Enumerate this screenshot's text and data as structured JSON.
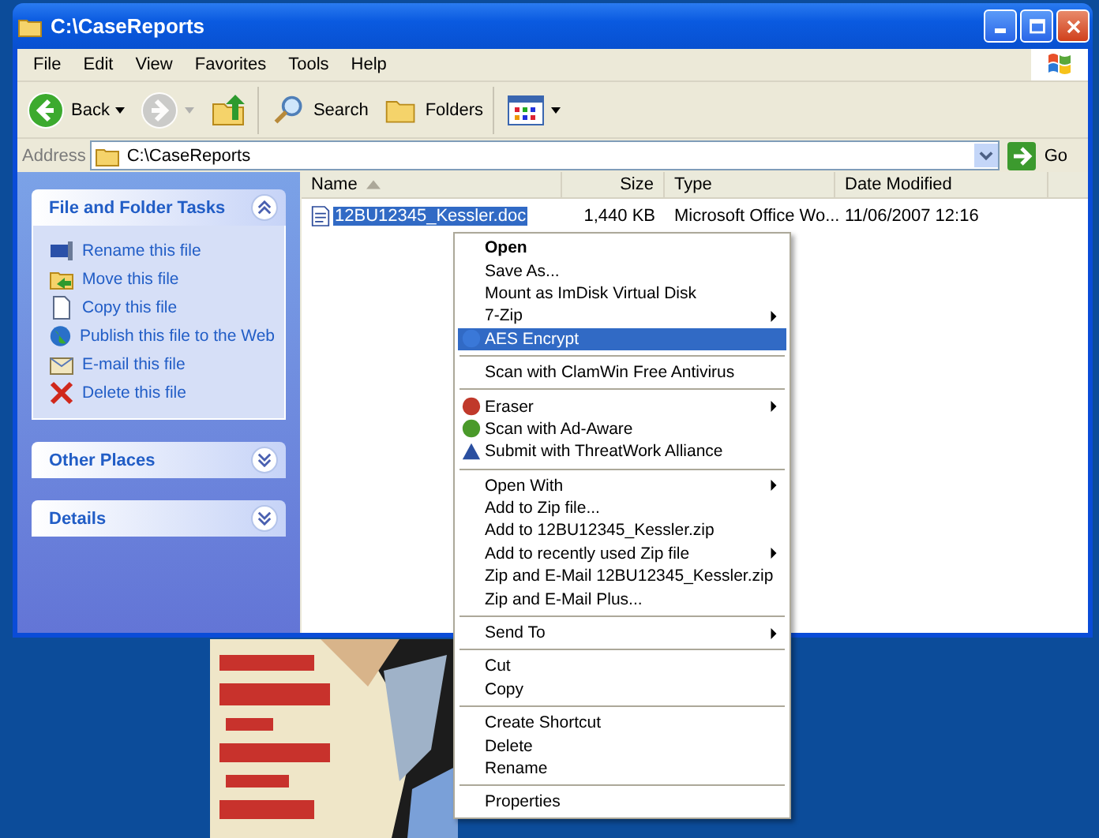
{
  "window": {
    "title": "C:\\CaseReports"
  },
  "menu_bar": [
    "File",
    "Edit",
    "View",
    "Favorites",
    "Tools",
    "Help"
  ],
  "toolbar": [
    {
      "kind": "back",
      "label": "Back",
      "disabled": false
    },
    {
      "kind": "forward",
      "disabled": true
    },
    {
      "kind": "up",
      "disabled": false
    },
    {
      "kind": "search",
      "label": "Search",
      "disabled": false
    },
    {
      "kind": "folders",
      "label": "Folders",
      "disabled": false
    },
    {
      "kind": "views",
      "disabled": false
    }
  ],
  "address_bar": {
    "label": "Address",
    "value": "C:\\CaseReports",
    "go": "Go"
  },
  "task_pane": [
    {
      "title": "File and Folder Tasks",
      "expanded": true,
      "items": [
        "Rename this file",
        "Move this file",
        "Copy this file",
        "Publish this file to the Web",
        "E-mail this file",
        "Delete this file"
      ]
    },
    {
      "title": "Other Places",
      "expanded": false
    },
    {
      "title": "Details",
      "expanded": false
    }
  ],
  "file_list": {
    "columns": [
      {
        "label": "Name",
        "sorted": true
      },
      {
        "label": "Size",
        "sorted": false
      },
      {
        "label": "Type",
        "sorted": false
      },
      {
        "label": "Date Modified",
        "sorted": false
      }
    ],
    "rows": [
      {
        "name": "12BU12345_Kessler.doc",
        "size": "1,440 KB",
        "type": "Microsoft Office Wo...",
        "date": "11/06/2007 12:16",
        "selected": true
      }
    ]
  },
  "context_menu": [
    [
      {
        "label": "Open",
        "default": true,
        "submenu": false,
        "icon": false,
        "selected": false
      },
      {
        "label": "Save As...",
        "default": false,
        "submenu": false,
        "icon": false,
        "selected": false
      },
      {
        "label": "Mount as ImDisk Virtual Disk",
        "default": false,
        "submenu": false,
        "icon": false,
        "selected": false
      },
      {
        "label": "7-Zip",
        "default": false,
        "submenu": true,
        "icon": false,
        "selected": false
      },
      {
        "label": "AES Encrypt",
        "default": false,
        "submenu": false,
        "icon": true,
        "selected": true
      }
    ],
    [
      {
        "label": "Scan with ClamWin Free Antivirus",
        "default": false,
        "submenu": false,
        "icon": false,
        "selected": false
      }
    ],
    [
      {
        "label": "Eraser",
        "default": false,
        "submenu": true,
        "icon": true,
        "selected": false
      },
      {
        "label": "Scan with Ad-Aware",
        "default": false,
        "submenu": false,
        "icon": true,
        "selected": false
      },
      {
        "label": "Submit with ThreatWork Alliance",
        "default": false,
        "submenu": false,
        "icon": true,
        "selected": false
      }
    ],
    [
      {
        "label": "Open With",
        "default": false,
        "submenu": true,
        "icon": false,
        "selected": false
      },
      {
        "label": "Add to Zip file...",
        "default": false,
        "submenu": false,
        "icon": false,
        "selected": false
      },
      {
        "label": "Add to 12BU12345_Kessler.zip",
        "default": false,
        "submenu": false,
        "icon": false,
        "selected": false
      },
      {
        "label": "Add to recently used Zip file",
        "default": false,
        "submenu": true,
        "icon": false,
        "selected": false
      },
      {
        "label": "Zip and E-Mail 12BU12345_Kessler.zip",
        "default": false,
        "submenu": false,
        "icon": false,
        "selected": false
      },
      {
        "label": "Zip and E-Mail Plus...",
        "default": false,
        "submenu": false,
        "icon": false,
        "selected": false
      }
    ],
    [
      {
        "label": "Send To",
        "default": false,
        "submenu": true,
        "icon": false,
        "selected": false
      }
    ],
    [
      {
        "label": "Cut",
        "default": false,
        "submenu": false,
        "icon": false,
        "selected": false
      },
      {
        "label": "Copy",
        "default": false,
        "submenu": false,
        "icon": false,
        "selected": false
      }
    ],
    [
      {
        "label": "Create Shortcut",
        "default": false,
        "submenu": false,
        "icon": false,
        "selected": false
      },
      {
        "label": "Delete",
        "default": false,
        "submenu": false,
        "icon": false,
        "selected": false
      },
      {
        "label": "Rename",
        "default": false,
        "submenu": false,
        "icon": false,
        "selected": false
      }
    ],
    [
      {
        "label": "Properties",
        "default": false,
        "submenu": false,
        "icon": false,
        "selected": false
      }
    ]
  ],
  "desktop": {
    "kind": "picture"
  }
}
